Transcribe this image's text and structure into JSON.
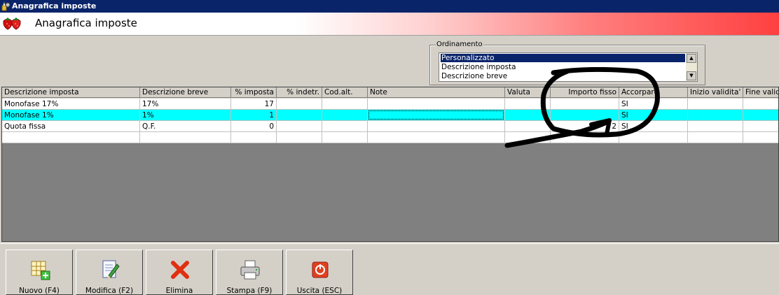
{
  "window": {
    "title": "Anagrafica imposte"
  },
  "header": {
    "title": "Anagrafica imposte"
  },
  "ordinamento": {
    "legend": "Ordinamento",
    "options": [
      "Personalizzato",
      "Descrizione imposta",
      "Descrizione breve"
    ],
    "selected": "Personalizzato"
  },
  "grid": {
    "columns": [
      "Descrizione imposta",
      "Descrizione breve",
      "% imposta",
      "% indetr.",
      "Cod.alt.",
      "Note",
      "Valuta",
      "Importo fisso",
      "Accorpare",
      "Inizio validita'",
      "Fine validi"
    ],
    "rows": [
      {
        "descrizione": "Monofase 17%",
        "breve": "17%",
        "imposta": "17",
        "indetr": "",
        "codalt": "",
        "note": "",
        "valuta": "",
        "importo": "",
        "accorpare": "SI",
        "inizio": "",
        "fine": ""
      },
      {
        "descrizione": "Monofase 1%",
        "breve": "1%",
        "imposta": "1",
        "indetr": "",
        "codalt": "",
        "note": "",
        "valuta": "",
        "importo": "",
        "accorpare": "SI",
        "inizio": "",
        "fine": ""
      },
      {
        "descrizione": "Quota fissa",
        "breve": "Q.F.",
        "imposta": "0",
        "indetr": "",
        "codalt": "",
        "note": "",
        "valuta": "",
        "importo": "2",
        "accorpare": "SI",
        "inizio": "",
        "fine": ""
      }
    ],
    "selected_row": 1
  },
  "toolbar": {
    "nuovo": "Nuovo (F4)",
    "modifica": "Modifica (F2)",
    "elimina": "Elimina",
    "stampa": "Stampa (F9)",
    "uscita": "Uscita (ESC)"
  },
  "colors": {
    "titlebar": "#0a246a",
    "selection": "#00ffff",
    "header_gradient_end": "#ff4040"
  }
}
